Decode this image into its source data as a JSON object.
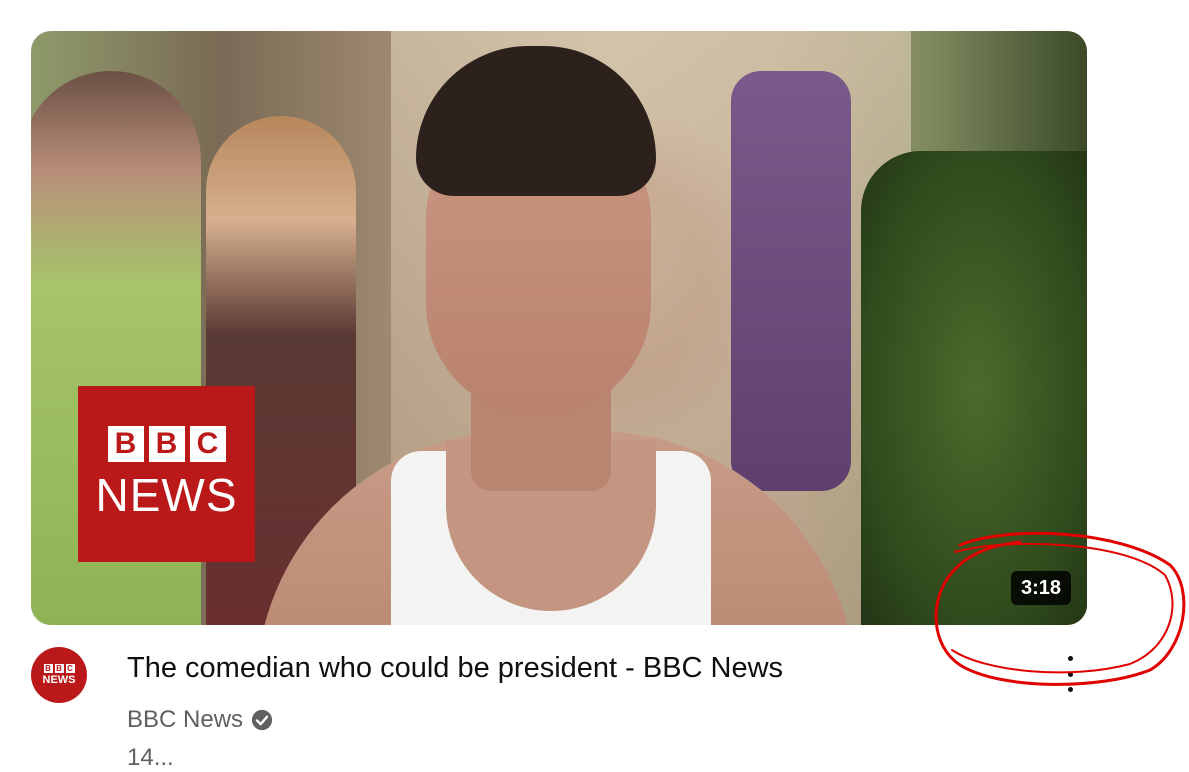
{
  "video": {
    "title": "The comedian who could be president - BBC News",
    "duration": "3:18",
    "channel": "BBC News",
    "meta": "14..."
  },
  "thumbnail": {
    "logo_letters": [
      "B",
      "B",
      "C"
    ],
    "logo_word": "NEWS"
  },
  "avatar": {
    "letters": [
      "B",
      "B",
      "C"
    ],
    "word": "NEWS"
  },
  "icons": {
    "verified": "verified-check-icon",
    "menu": "more-vert-icon"
  },
  "colors": {
    "bbc_red": "#bb1919",
    "annotation": "#e00000",
    "text_primary": "#0f0f0f",
    "text_secondary": "#606060"
  }
}
